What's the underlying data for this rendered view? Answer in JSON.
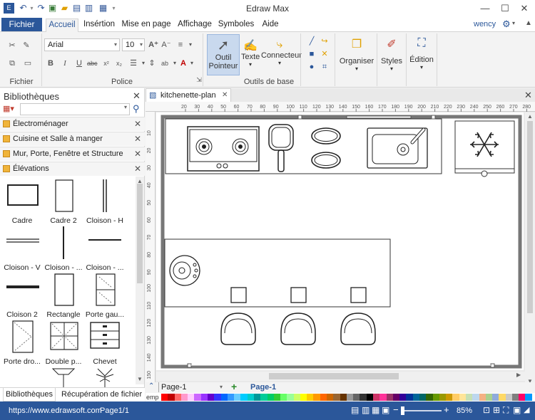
{
  "app": {
    "title": "Edraw Max",
    "user": "wency"
  },
  "menu": {
    "file": "Fichier",
    "tabs": [
      "Accueil",
      "Insértion",
      "Mise en page",
      "Affichage",
      "Symboles",
      "Aide"
    ]
  },
  "ribbon": {
    "font": "Arial",
    "size": "10",
    "groups": {
      "file": "Fichier",
      "font": "Police",
      "tools": "Outils de base"
    },
    "buttons": {
      "pointer1": "Outil",
      "pointer2": "Pointeur",
      "text": "Texte",
      "connector": "Connecteur",
      "organize": "Organiser",
      "styles": "Styles",
      "edition": "Édition"
    }
  },
  "library": {
    "title": "Bibliothèques",
    "sections": [
      "Électroménager",
      "Cuisine et Salle à manger",
      "Mur, Porte, Fenêtre et Structure",
      "Élévations"
    ],
    "shapes": [
      "Cadre",
      "Cadre 2",
      "Cloison - H",
      "Cloison - V",
      "Cloison - ...",
      "Cloison - ...",
      "Cloison 2",
      "Rectangle",
      "Porte gau...",
      "Porte dro...",
      "Double p...",
      "Chevet"
    ],
    "bottom_tabs": [
      "Bibliothèques",
      "Récupération de fichier"
    ]
  },
  "document": {
    "tab": "kitchenette-plan",
    "page_selector": "Page-1",
    "page_tab": "Page-1",
    "color_label": "emp"
  },
  "ruler": {
    "top": [
      "20",
      "30",
      "40",
      "50",
      "60",
      "70",
      "80",
      "90",
      "100",
      "110",
      "120",
      "130",
      "140",
      "150",
      "160",
      "170",
      "180",
      "190",
      "200",
      "210",
      "220",
      "230",
      "240",
      "250",
      "260",
      "270",
      "280",
      "290"
    ],
    "left": [
      "10",
      "20",
      "30",
      "40",
      "50",
      "60",
      "70",
      "80",
      "90",
      "100",
      "110",
      "120",
      "130",
      "140",
      "150",
      "160"
    ]
  },
  "status": {
    "url": "https://www.edrawsoft.com",
    "page": "Page1/1",
    "zoom": "85%"
  },
  "palette": [
    "#ff0000",
    "#c00000",
    "#ff6666",
    "#ff99cc",
    "#ffccff",
    "#cc66ff",
    "#9933ff",
    "#6600cc",
    "#3333ff",
    "#0066ff",
    "#3399ff",
    "#66ccff",
    "#00ccff",
    "#00cccc",
    "#009999",
    "#00cc99",
    "#00cc66",
    "#33cc33",
    "#66ff66",
    "#99ff99",
    "#ccff66",
    "#ffff00",
    "#ffcc00",
    "#ff9900",
    "#ff6600",
    "#cc6600",
    "#996633",
    "#663300",
    "#999999",
    "#666666",
    "#333333",
    "#000000",
    "#cc3366",
    "#ff3399",
    "#993366",
    "#660066",
    "#330099",
    "#003399",
    "#006699",
    "#006666",
    "#336600",
    "#669900",
    "#999900",
    "#cc9900",
    "#ffcc66",
    "#ffe599",
    "#c6e0b4",
    "#bdd7ee",
    "#f4b183",
    "#a9d18e",
    "#8faadc",
    "#ffd966",
    "#c9c9c9",
    "#7f7f7f",
    "#ff0066",
    "#0099ff"
  ]
}
